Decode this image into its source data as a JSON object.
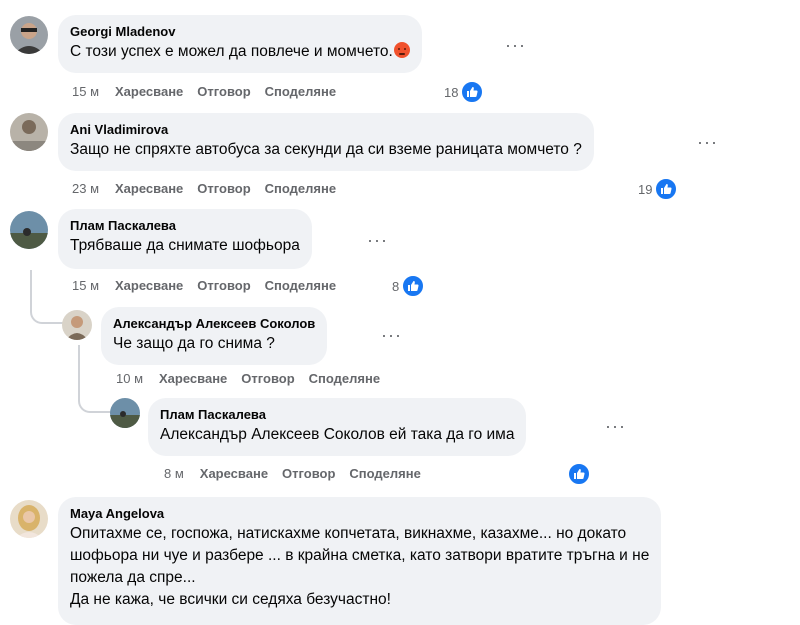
{
  "comments": [
    {
      "author": "Georgi Mladenov",
      "text": "С този успех е можел да повлече и момчето.",
      "emoji": "angry-face",
      "time": "15 м",
      "like": "Харесване",
      "reply": "Отговор",
      "share": "Споделяне",
      "count": "18"
    },
    {
      "author": "Ani Vladimirova",
      "text": "Защо не спряхте автобуса за секунди да си вземе раницата момчето ?",
      "time": "23 м",
      "like": "Харесване",
      "reply": "Отговор",
      "share": "Споделяне",
      "count": "19"
    },
    {
      "author": "Плам Паскалева",
      "text": "Трябваше да снимате шофьора",
      "time": "15 м",
      "like": "Харесване",
      "reply": "Отговор",
      "share": "Споделяне",
      "count": "8"
    },
    {
      "author": "Александър Алексеев Соколов",
      "text": "Че защо да го снима ?",
      "time": "10 м",
      "like": "Харесване",
      "reply": "Отговор",
      "share": "Споделяне"
    },
    {
      "author": "Плам Паскалева",
      "text": "Александър Алексеев Соколов ей така да го има",
      "time": "8 м",
      "like": "Харесване",
      "reply": "Отговор",
      "share": "Споделяне"
    },
    {
      "author": "Maya Angelova",
      "lines": [
        "Опитахме се, госпожа, натискахме копчетата, викнахме, казахме... но докато",
        "шофьора ни чуе и разбере ... в крайна сметка, като затвори вратите тръгна и не",
        "пожела да спре...",
        "Да не кажа, че всички си седяха безучастно!"
      ]
    }
  ],
  "colors": {
    "bubble": "#f0f2f5",
    "meta": "#65676b",
    "like_blue": "#1877f2",
    "angry": "#f0512c"
  },
  "more_icon": "ellipsis-icon",
  "like_icon": "thumbs-up-icon"
}
